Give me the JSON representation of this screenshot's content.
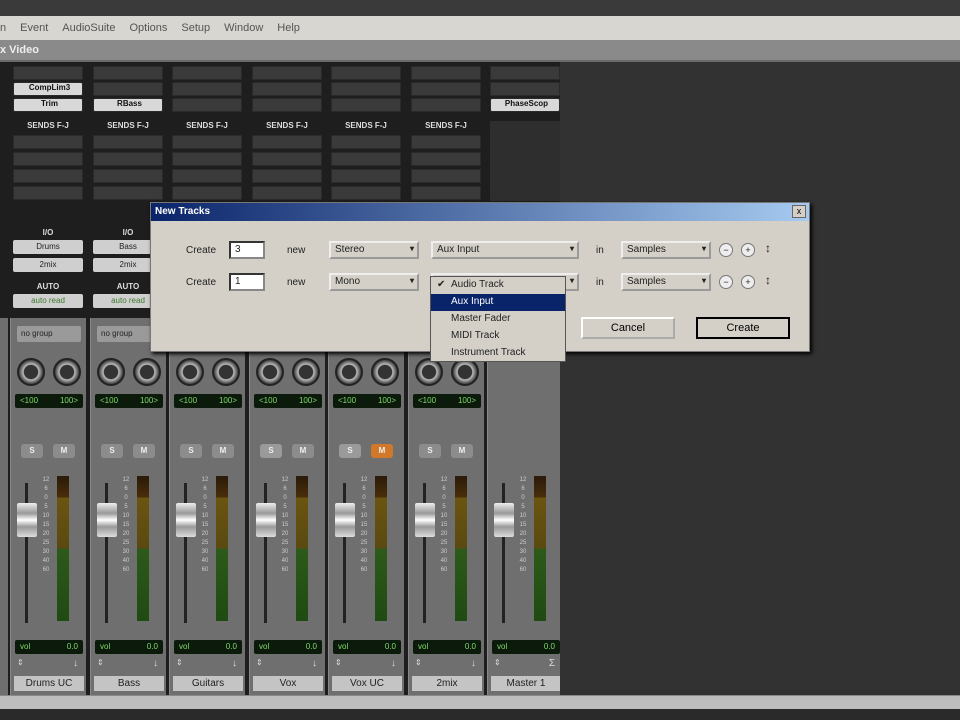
{
  "menu": [
    "n",
    "Event",
    "AudioSuite",
    "Options",
    "Setup",
    "Window",
    "Help"
  ],
  "window_title": "x Video",
  "sends_label": "SENDS F-J",
  "io_label": "I/O",
  "auto_label": "AUTO",
  "strips": [
    {
      "name": "Drums UC",
      "inserts": [
        "",
        "CompLim3",
        "Trim"
      ],
      "sends": true,
      "io_in": "Drums",
      "io_out": "2mix",
      "auto": "auto read",
      "group": "no group",
      "pan": [
        "<100",
        "100>"
      ],
      "vol_label": "vol",
      "vol": "0.0",
      "solo": false,
      "mute": false
    },
    {
      "name": "Bass",
      "inserts": [
        "",
        "",
        "RBass"
      ],
      "sends": true,
      "io_in": "Bass",
      "io_out": "2mix",
      "auto": "auto read",
      "group": "no group",
      "pan": [
        "<100",
        "100>"
      ],
      "vol_label": "vol",
      "vol": "0.0",
      "solo": false,
      "mute": false
    },
    {
      "name": "Guitars",
      "inserts": [
        "",
        "",
        ""
      ],
      "sends": true,
      "pan": [
        "<100",
        "100>"
      ],
      "vol_label": "vol",
      "vol": "0.0",
      "solo": false,
      "mute": false
    },
    {
      "name": "Vox",
      "inserts": [
        "",
        "",
        ""
      ],
      "sends": true,
      "pan": [
        "<100",
        "100>"
      ],
      "vol_label": "vol",
      "vol": "0.0",
      "solo": true,
      "mute": false
    },
    {
      "name": "Vox UC",
      "inserts": [
        "",
        "",
        ""
      ],
      "sends": true,
      "pan": [
        "<100",
        "100>"
      ],
      "vol_label": "vol",
      "vol": "0.0",
      "solo": true,
      "mute": true
    },
    {
      "name": "2mix",
      "inserts": [
        "",
        "",
        ""
      ],
      "sends": true,
      "pan": [
        "<100",
        "100>"
      ],
      "vol_label": "vol",
      "vol": "0.0",
      "solo": false,
      "mute": false
    },
    {
      "name": "Master 1",
      "inserts": [
        "",
        "",
        "PhaseScop"
      ],
      "sends": false,
      "vol_label": "vol",
      "vol": "0.0",
      "master": true
    }
  ],
  "solo_label": "S",
  "mute_label": "M",
  "scale": [
    "12",
    "6",
    "0",
    "5",
    "10",
    "15",
    "20",
    "25",
    "30",
    "40",
    "60"
  ],
  "dialog": {
    "title": "New Tracks",
    "close": "x",
    "rows": [
      {
        "create_label": "Create",
        "count": "3",
        "new_label": "new",
        "format": "Stereo",
        "type": "Aux Input",
        "in_label": "in",
        "timebase": "Samples"
      },
      {
        "create_label": "Create",
        "count": "1",
        "new_label": "new",
        "format": "Mono",
        "type": "",
        "in_label": "in",
        "timebase": "Samples"
      }
    ],
    "cancel": "Cancel",
    "create": "Create",
    "type_menu": [
      {
        "label": "Audio Track",
        "checked": true
      },
      {
        "label": "Aux Input",
        "highlighted": true
      },
      {
        "label": "Master Fader"
      },
      {
        "label": "MIDI Track"
      },
      {
        "label": "Instrument Track"
      }
    ]
  }
}
